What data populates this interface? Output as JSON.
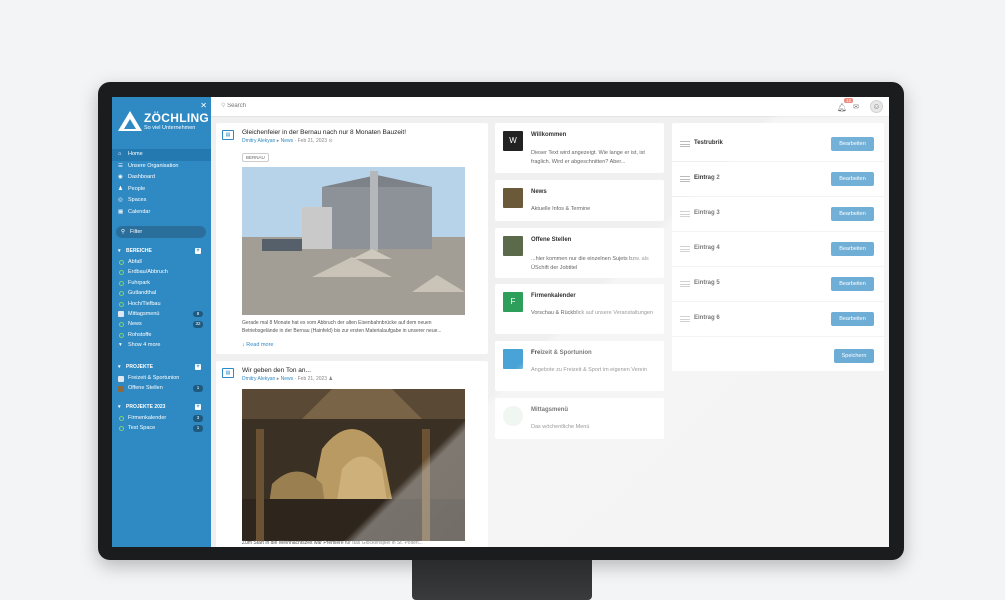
{
  "sidebar": {
    "logo_title": "ZÖCHLING",
    "logo_sub": "So viel Unternehmen",
    "nav": [
      {
        "label": "Home",
        "icon": "home-icon"
      },
      {
        "label": "Unsere Organisation",
        "icon": "list-icon"
      },
      {
        "label": "Dashboard",
        "icon": "dashboard-icon"
      },
      {
        "label": "People",
        "icon": "people-icon"
      },
      {
        "label": "Spaces",
        "icon": "spaces-icon"
      },
      {
        "label": "Calendar",
        "icon": "calendar-icon"
      }
    ],
    "filter_label": "Filter",
    "bereiche": {
      "title": "BEREICHE",
      "items": [
        {
          "label": "Abfall"
        },
        {
          "label": "Erdbau/Abbruch"
        },
        {
          "label": "Fuhrpark"
        },
        {
          "label": "Gutlandthal"
        },
        {
          "label": "Hoch/Tiefbau"
        },
        {
          "label": "Mittagsmenü",
          "badge": "8"
        },
        {
          "label": "News",
          "badge": "32"
        },
        {
          "label": "Rohstoffe"
        }
      ],
      "show_more": "Show 4 more"
    },
    "projekte": {
      "title": "PROJEKTE",
      "items": [
        {
          "label": "Freizeit & Sportunion"
        },
        {
          "label": "Offene Stellen",
          "badge": "1"
        }
      ]
    },
    "projekte2023": {
      "title": "PROJEKTE 2023",
      "items": [
        {
          "label": "Firmenkalender",
          "badge": "3"
        },
        {
          "label": "Test Space",
          "badge": "1"
        }
      ]
    }
  },
  "topbar": {
    "search_placeholder": "Search",
    "notification_count": "12"
  },
  "feed": {
    "posts": [
      {
        "title": "Gleichenfeier in der Bernau nach nur 8 Monaten Bauzeit!",
        "author": "Dmitry Alekyan",
        "space": "News",
        "date": "Feb 21, 2023",
        "tag": "BERNAU",
        "text": "Gerade mal 8 Monate hat es vom Abbruch der alten Eisenbahnbrücke auf dem neuen Betriebsgelände in der Bernau (Hainfeld) bis zur ersten Materialaufgabe in unserer neue...",
        "read_more": "Read more"
      },
      {
        "title": "Wir geben den Ton an...",
        "author": "Dmitry Alekyan",
        "space": "News",
        "date": "Feb 21, 2023",
        "text": "Zum Start in die Weihnachtszeit war Premiere für das Glockenspiel in St. Pölten..."
      }
    ]
  },
  "middle": {
    "cards": [
      {
        "title": "Willkommen",
        "thumb": "W",
        "thumb_color": "#222222",
        "desc": "Dieser Text wird angezeigt. Wie lange er ist, ist fraglich. Wird er abgeschnitten? Aber..."
      },
      {
        "title": "News",
        "thumb": "",
        "thumb_color": "#6b5a3a",
        "desc": "Aktuelle Infos & Termine"
      },
      {
        "title": "Offene Stellen",
        "thumb": "",
        "thumb_color": "#5a6a4a",
        "desc": "...hier kommen nur die einzelnen Sujets bzw. als ÜSchift der Jobtitel"
      },
      {
        "title": "Firmenkalender",
        "thumb": "F",
        "thumb_color": "#2e9e5b",
        "desc": "Vorschau & Rückblick auf unsere Veranstaltungen"
      },
      {
        "title": "Freizeit & Sportunion",
        "thumb": "",
        "thumb_color": "#4aa3d6",
        "desc": "Angebote zu Freizeit & Sport im eigenen Verein"
      },
      {
        "title": "Mittagsmenü",
        "thumb": "",
        "thumb_color": "#e9f2ec",
        "desc": "Das wöchentliche Menü"
      }
    ]
  },
  "rubrics": {
    "rows": [
      {
        "label": "Testrubrik"
      },
      {
        "label": "Eintrag 2"
      },
      {
        "label": "Eintrag 3"
      },
      {
        "label": "Eintrag 4"
      },
      {
        "label": "Eintrag 5"
      },
      {
        "label": "Eintrag 6"
      }
    ],
    "edit_label": "Bearbeiten",
    "save_label": "Speichern"
  },
  "colors": {
    "accent": "#2f8ac4",
    "sidebar": "#2f8ac4"
  }
}
